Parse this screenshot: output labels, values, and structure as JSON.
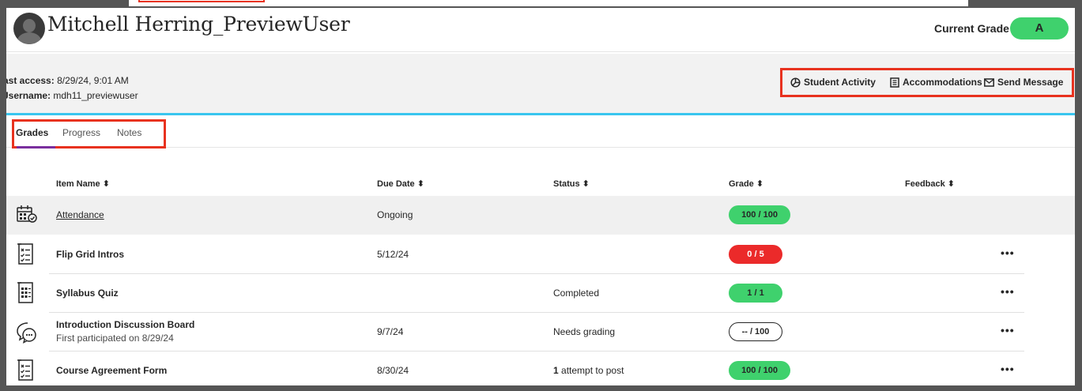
{
  "header": {
    "user_name": "Mitchell Herring_PreviewUser",
    "current_grade_label": "Current Grade",
    "current_grade_value": "A"
  },
  "info": {
    "last_access_label": "ast access:",
    "last_access_value": "8/29/24, 9:01 AM",
    "username_label": "Jsername:",
    "username_value": "mdh11_previewuser"
  },
  "actions": [
    {
      "label": "Student Activity",
      "icon": "activity-icon"
    },
    {
      "label": "Accommodations",
      "icon": "document-icon"
    },
    {
      "label": "Send Message",
      "icon": "envelope-icon"
    }
  ],
  "tabs": [
    {
      "label": "Grades",
      "active": true
    },
    {
      "label": "Progress",
      "active": false
    },
    {
      "label": "Notes",
      "active": false
    }
  ],
  "columns": {
    "item_name": "Item Name ⬍",
    "due_date": "Due Date ⬍",
    "status": "Status ⬍",
    "grade": "Grade ⬍",
    "feedback": "Feedback ⬍"
  },
  "rows": [
    {
      "icon": "attendance-calendar-icon",
      "name": "Attendance",
      "sub": "",
      "due": "Ongoing",
      "status_bold": "",
      "status": "",
      "grade": "100 / 100",
      "grade_style": "green",
      "more": ""
    },
    {
      "icon": "assignment-checklist-icon",
      "name": "Flip Grid Intros",
      "sub": "",
      "due": "5/12/24",
      "status_bold": "",
      "status": "",
      "grade": "0 / 5",
      "grade_style": "red",
      "more": "•••"
    },
    {
      "icon": "quiz-grid-icon",
      "name": "Syllabus Quiz",
      "sub": "",
      "due": "",
      "status_bold": "",
      "status": "Completed",
      "grade": "1 / 1",
      "grade_style": "green",
      "more": "•••"
    },
    {
      "icon": "discussion-bubble-icon",
      "name": "Introduction Discussion Board",
      "sub": "First participated on 8/29/24",
      "due": "9/7/24",
      "status_bold": "",
      "status": "Needs grading",
      "grade": "-- / 100",
      "grade_style": "outline",
      "more": "•••"
    },
    {
      "icon": "assignment-checklist-icon",
      "name": "Course Agreement Form",
      "sub": "",
      "due": "8/30/24",
      "status_bold": "1",
      "status": " attempt to post",
      "grade": "100 / 100",
      "grade_style": "green",
      "more": "•••"
    }
  ],
  "colors": {
    "accent_green": "#3fd16d",
    "accent_red": "#eb2a2a",
    "highlight_box": "#e8321f",
    "tab_underline": "#7a2f9e",
    "band_border": "#39c6ef"
  }
}
